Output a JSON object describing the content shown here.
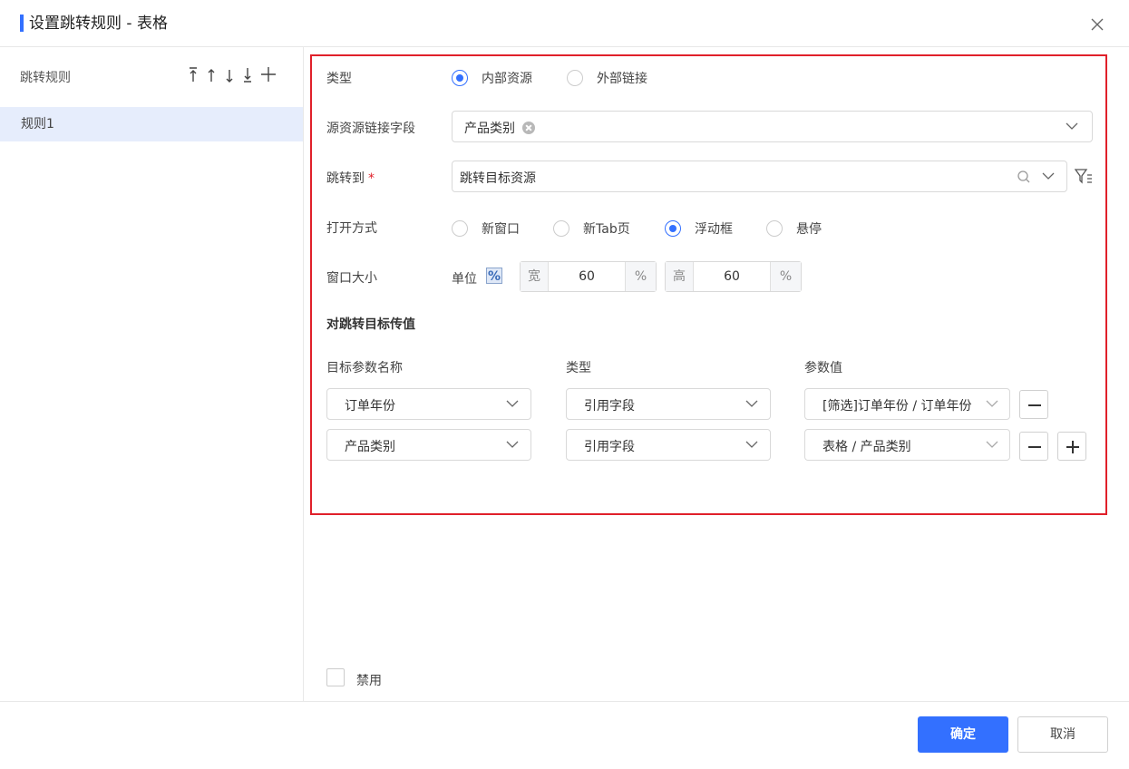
{
  "dialog": {
    "title": "设置跳转规则 - 表格"
  },
  "colors": {
    "accent": "#3370ff",
    "highlight_border": "#e0202a",
    "selected_row": "#e6edfc"
  },
  "left_panel": {
    "title": "跳转规则",
    "tools": [
      "move-to-top-icon",
      "move-up-icon",
      "move-down-icon",
      "move-to-bottom-icon",
      "add-icon"
    ],
    "rules": [
      {
        "label": "规则1",
        "selected": true
      }
    ]
  },
  "form": {
    "type": {
      "label": "类型",
      "options": [
        {
          "label": "内部资源",
          "checked": true
        },
        {
          "label": "外部链接",
          "checked": false
        }
      ]
    },
    "source_field": {
      "label": "源资源链接字段",
      "tags": [
        "产品类别"
      ]
    },
    "jump_to": {
      "label": "跳转到",
      "required_mark": "*",
      "value": "跳转目标资源"
    },
    "open_mode": {
      "label": "打开方式",
      "options": [
        {
          "label": "新窗口",
          "checked": false
        },
        {
          "label": "新Tab页",
          "checked": false
        },
        {
          "label": "浮动框",
          "checked": true
        },
        {
          "label": "悬停",
          "checked": false
        }
      ]
    },
    "window_size": {
      "label": "窗口大小",
      "unit_label": "单位",
      "unit_icon": "percent-icon",
      "width": {
        "prefix": "宽",
        "value": "60",
        "suffix": "%"
      },
      "height": {
        "prefix": "高",
        "value": "60",
        "suffix": "%"
      }
    },
    "params": {
      "section_title": "对跳转目标传值",
      "headers": [
        "目标参数名称",
        "类型",
        "参数值"
      ],
      "rows": [
        {
          "name": "订单年份",
          "type": "引用字段",
          "value": "[筛选]订单年份 / 订单年份"
        },
        {
          "name": "产品类别",
          "type": "引用字段",
          "value": "表格 / 产品类别"
        }
      ]
    },
    "disable": {
      "label": "禁用",
      "checked": false
    }
  },
  "footer": {
    "ok_label": "确定",
    "cancel_label": "取消"
  }
}
